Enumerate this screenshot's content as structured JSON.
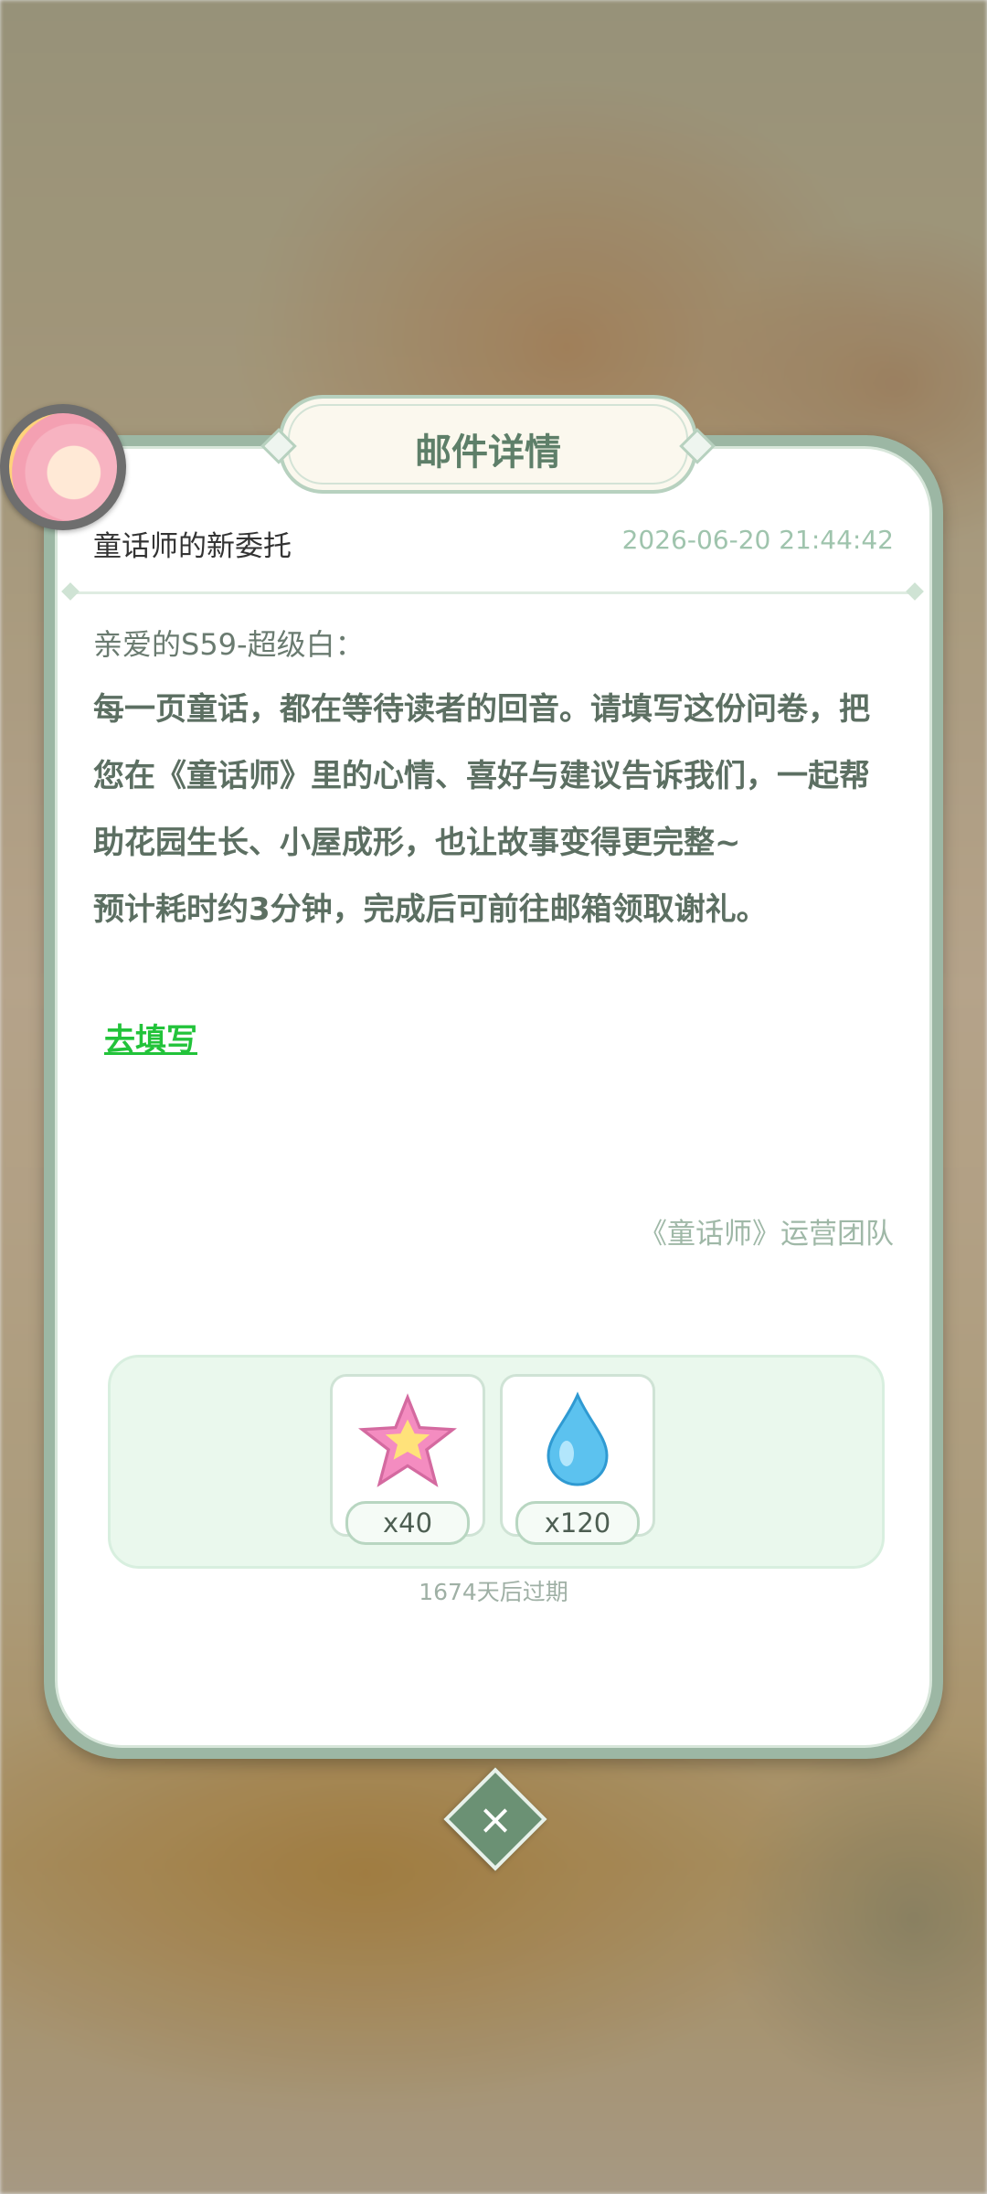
{
  "dialog": {
    "title": "邮件详情",
    "subject": "童话师的新委托",
    "timestamp": "2026-06-20 21:44:42",
    "greeting": "亲爱的S59-超级白：",
    "body": [
      "每一页童话，都在等待读者的回音。请填写这份问卷，把您在《童话师》里的心情、喜好与建议告诉我们，一起帮助花园生长、小屋成形，也让故事变得更完整~",
      "预计耗时约3分钟，完成后可前往邮箱领取谢礼。"
    ],
    "link_label": "去填写",
    "signature": "《童话师》运营团队"
  },
  "rewards": {
    "items": [
      {
        "icon": "star-icon",
        "count": "x40"
      },
      {
        "icon": "water-drop-icon",
        "count": "x120"
      }
    ],
    "expire_text": "1674天后过期"
  },
  "close": {
    "icon": "close-icon",
    "label": "×"
  },
  "colors": {
    "accent": "#5e7f69",
    "link": "#22c33a",
    "frame": "#9cb7a4"
  }
}
